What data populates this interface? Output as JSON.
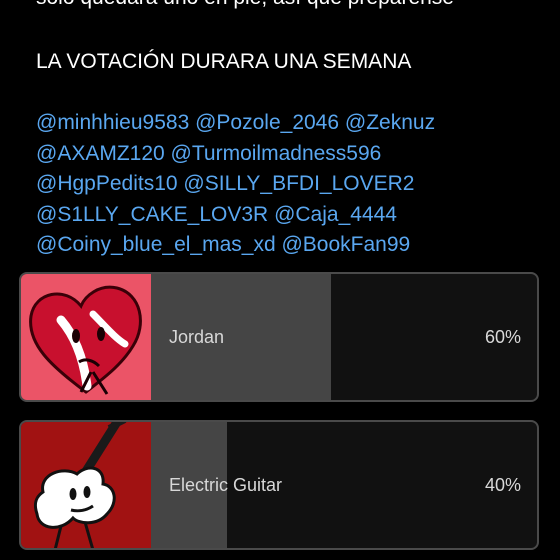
{
  "post": {
    "cut_line": "solo quedará uno en pie, así que prepárense",
    "heading": "LA VOTACIÓN DURARA UNA SEMANA",
    "mention_lines": [
      [
        "@minhhieu9583",
        "@Pozole_2046",
        "@Zeknuz"
      ],
      [
        "@AXAMZ120",
        "@Turmoilmadness596"
      ],
      [
        "@HgpPedits10",
        "@SILLY_BFDI_LOVER2"
      ],
      [
        "@S1LLY_CAKE_LOV3R",
        "@Caja_4444"
      ],
      [
        "@Coiny_blue_el_mas_xd",
        "@BookFan99"
      ]
    ]
  },
  "poll": {
    "options": [
      {
        "label": "Jordan",
        "percent_label": "60%",
        "percent": 60
      },
      {
        "label": "Electric Guitar",
        "percent_label": "40%",
        "percent": 40
      }
    ]
  },
  "colors": {
    "mention": "#5aa7f0",
    "fill": "#454545",
    "track": "#111111"
  }
}
